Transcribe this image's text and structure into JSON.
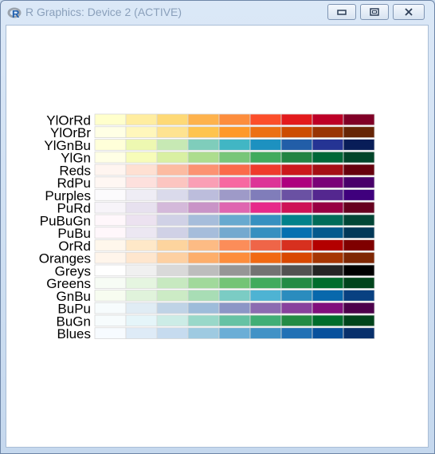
{
  "window": {
    "title": "R Graphics: Device 2 (ACTIVE)",
    "icons": {
      "app": "r-logo-icon",
      "minimize": "minimize-icon",
      "maximize": "maximize-icon",
      "close": "close-icon"
    }
  },
  "chart_data": {
    "type": "table",
    "title": "",
    "palettes": [
      {
        "name": "YlOrRd",
        "colors": [
          "#FFFFCC",
          "#FFEDA0",
          "#FED976",
          "#FEB24C",
          "#FD8D3C",
          "#FC4E2A",
          "#E31A1C",
          "#BD0026",
          "#800026"
        ]
      },
      {
        "name": "YlOrBr",
        "colors": [
          "#FFFFE5",
          "#FFF7BC",
          "#FEE391",
          "#FEC44F",
          "#FE9929",
          "#EC7014",
          "#CC4C02",
          "#993404",
          "#662506"
        ]
      },
      {
        "name": "YlGnBu",
        "colors": [
          "#FFFFD9",
          "#EDF8B1",
          "#C7E9B4",
          "#7FCDBB",
          "#41B6C4",
          "#1D91C0",
          "#225EA8",
          "#253494",
          "#081D58"
        ]
      },
      {
        "name": "YlGn",
        "colors": [
          "#FFFFE5",
          "#F7FCB9",
          "#D9F0A3",
          "#ADDD8E",
          "#78C679",
          "#41AB5D",
          "#238443",
          "#006837",
          "#004529"
        ]
      },
      {
        "name": "Reds",
        "colors": [
          "#FFF5F0",
          "#FEE0D2",
          "#FCBBA1",
          "#FC9272",
          "#FB6A4A",
          "#EF3B2C",
          "#CB181D",
          "#A50F15",
          "#67000D"
        ]
      },
      {
        "name": "RdPu",
        "colors": [
          "#FFF7F3",
          "#FDE0DD",
          "#FCC5C0",
          "#FA9FB5",
          "#F768A1",
          "#DD3497",
          "#AE017E",
          "#7A0177",
          "#49006A"
        ]
      },
      {
        "name": "Purples",
        "colors": [
          "#FCFBFD",
          "#EFEDF5",
          "#DADAEB",
          "#BCBDDC",
          "#9E9AC8",
          "#807DBA",
          "#6A51A3",
          "#54278F",
          "#3F007D"
        ]
      },
      {
        "name": "PuRd",
        "colors": [
          "#F7F4F9",
          "#E7E1EF",
          "#D4B9DA",
          "#C994C7",
          "#DF65B0",
          "#E7298A",
          "#CE1256",
          "#980043",
          "#67001F"
        ]
      },
      {
        "name": "PuBuGn",
        "colors": [
          "#FFF7FB",
          "#ECE2F0",
          "#D0D1E6",
          "#A6BDDB",
          "#67A9CF",
          "#3690C0",
          "#02818A",
          "#016C59",
          "#014636"
        ]
      },
      {
        "name": "PuBu",
        "colors": [
          "#FFF7FB",
          "#ECE7F2",
          "#D0D1E6",
          "#A6BDDB",
          "#74A9CF",
          "#3690C0",
          "#0570B0",
          "#045A8D",
          "#023858"
        ]
      },
      {
        "name": "OrRd",
        "colors": [
          "#FFF7EC",
          "#FEE8C8",
          "#FDD49E",
          "#FDBB84",
          "#FC8D59",
          "#EF6548",
          "#D7301F",
          "#B30000",
          "#7F0000"
        ]
      },
      {
        "name": "Oranges",
        "colors": [
          "#FFF5EB",
          "#FEE6CE",
          "#FDD0A2",
          "#FDAE6B",
          "#FD8D3C",
          "#F16913",
          "#D94801",
          "#A63603",
          "#7F2704"
        ]
      },
      {
        "name": "Greys",
        "colors": [
          "#FFFFFF",
          "#F0F0F0",
          "#D9D9D9",
          "#BDBDBD",
          "#969696",
          "#737373",
          "#525252",
          "#252525",
          "#000000"
        ]
      },
      {
        "name": "Greens",
        "colors": [
          "#F7FCF5",
          "#E5F5E0",
          "#C7E9C0",
          "#A1D99B",
          "#74C476",
          "#41AB5D",
          "#238B45",
          "#006D2C",
          "#00441B"
        ]
      },
      {
        "name": "GnBu",
        "colors": [
          "#F7FCF0",
          "#E0F3DB",
          "#CCEBC5",
          "#A8DDB5",
          "#7BCCC4",
          "#4EB3D3",
          "#2B8CBE",
          "#0868AC",
          "#084081"
        ]
      },
      {
        "name": "BuPu",
        "colors": [
          "#F7FCFD",
          "#E0ECF4",
          "#BFD3E6",
          "#9EBCDA",
          "#8C96C6",
          "#8C6BB1",
          "#88419D",
          "#810F7C",
          "#4D004B"
        ]
      },
      {
        "name": "BuGn",
        "colors": [
          "#F7FCFD",
          "#E5F5F9",
          "#CCECE6",
          "#99D8C9",
          "#66C2A4",
          "#41AE76",
          "#238B45",
          "#006D2C",
          "#00441B"
        ]
      },
      {
        "name": "Blues",
        "colors": [
          "#F7FBFF",
          "#DEEBF7",
          "#C6DBEF",
          "#9ECAE1",
          "#6BAED6",
          "#4292C6",
          "#2171B5",
          "#08519C",
          "#08306B"
        ]
      }
    ]
  }
}
